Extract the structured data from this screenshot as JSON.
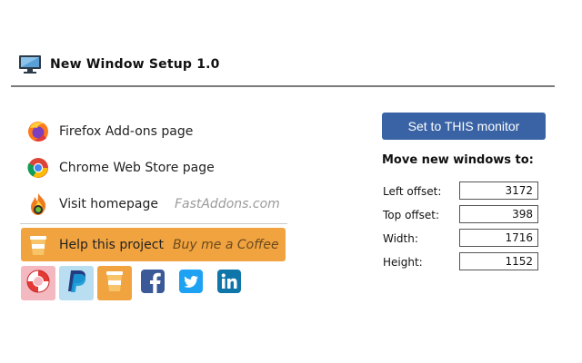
{
  "header": {
    "title": "New Window Setup 1.0",
    "icon": "monitor-icon"
  },
  "links": [
    {
      "label": "Firefox Add-ons page",
      "icon": "firefox-icon"
    },
    {
      "label": "Chrome Web Store page",
      "icon": "chrome-icon"
    },
    {
      "label": "Visit homepage",
      "sub": "FastAddons.com",
      "icon": "fastaddons-icon"
    }
  ],
  "help": {
    "label": "Help this project",
    "sub": "Buy me a Coffee",
    "icon": "coffee-cup-icon"
  },
  "social": [
    "lifebuoy-icon",
    "paypal-icon",
    "coffee-cup-icon",
    "facebook-icon",
    "twitter-icon",
    "linkedin-icon"
  ],
  "right_panel": {
    "button_label": "Set to THIS monitor",
    "move_title": "Move new windows to:",
    "fields": [
      {
        "label": "Left offset:",
        "value": "3172"
      },
      {
        "label": "Top offset:",
        "value": "398"
      },
      {
        "label": "Width:",
        "value": "1716"
      },
      {
        "label": "Height:",
        "value": "1152"
      }
    ]
  },
  "colors": {
    "accent_button": "#3a63a6",
    "help_bar": "#f0a33f",
    "divider": "#7a7a7a",
    "muted_text": "#9a9a9a"
  }
}
